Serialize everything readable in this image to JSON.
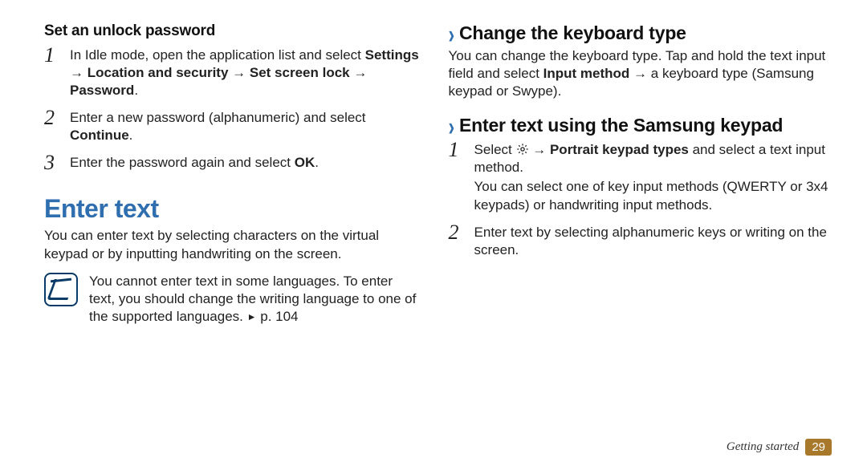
{
  "left": {
    "h3": "Set an unlock password",
    "steps": [
      {
        "num": "1",
        "pre": "In Idle mode, open the application list and select ",
        "bold": "Settings → Location and security → Set screen lock → Password",
        "post": "."
      },
      {
        "num": "2",
        "pre": "Enter a new password (alphanumeric) and select ",
        "bold": "Continue",
        "post": "."
      },
      {
        "num": "3",
        "pre": "Enter the password again and select ",
        "bold": "OK",
        "post": "."
      }
    ],
    "h1": "Enter text",
    "intro": "You can enter text by selecting characters on the virtual keypad or by inputting handwriting on the screen.",
    "note": "You cannot enter text in some languages. To enter text, you should change the writing language to one of the supported languages. ",
    "note_ref": "p. 104"
  },
  "right": {
    "h2a": "Change the keyboard type",
    "pa": "You can change the keyboard type. Tap and hold the text input field and select ",
    "pa_bold": "Input method",
    "pa_post": " → a keyboard type (Samsung keypad or Swype).",
    "h2b": "Enter text using the Samsung keypad",
    "steps": [
      {
        "num": "1",
        "pre": "Select ",
        "gear": true,
        "mid": " → ",
        "bold": "Portrait keypad types",
        "post": " and select a text input method.",
        "sub": "You can select one of key input methods (QWERTY or 3x4 keypads) or handwriting input methods."
      },
      {
        "num": "2",
        "pre": "Enter text by selecting alphanumeric keys or writing on the screen."
      }
    ]
  },
  "footer": {
    "section": "Getting started",
    "page": "29"
  }
}
